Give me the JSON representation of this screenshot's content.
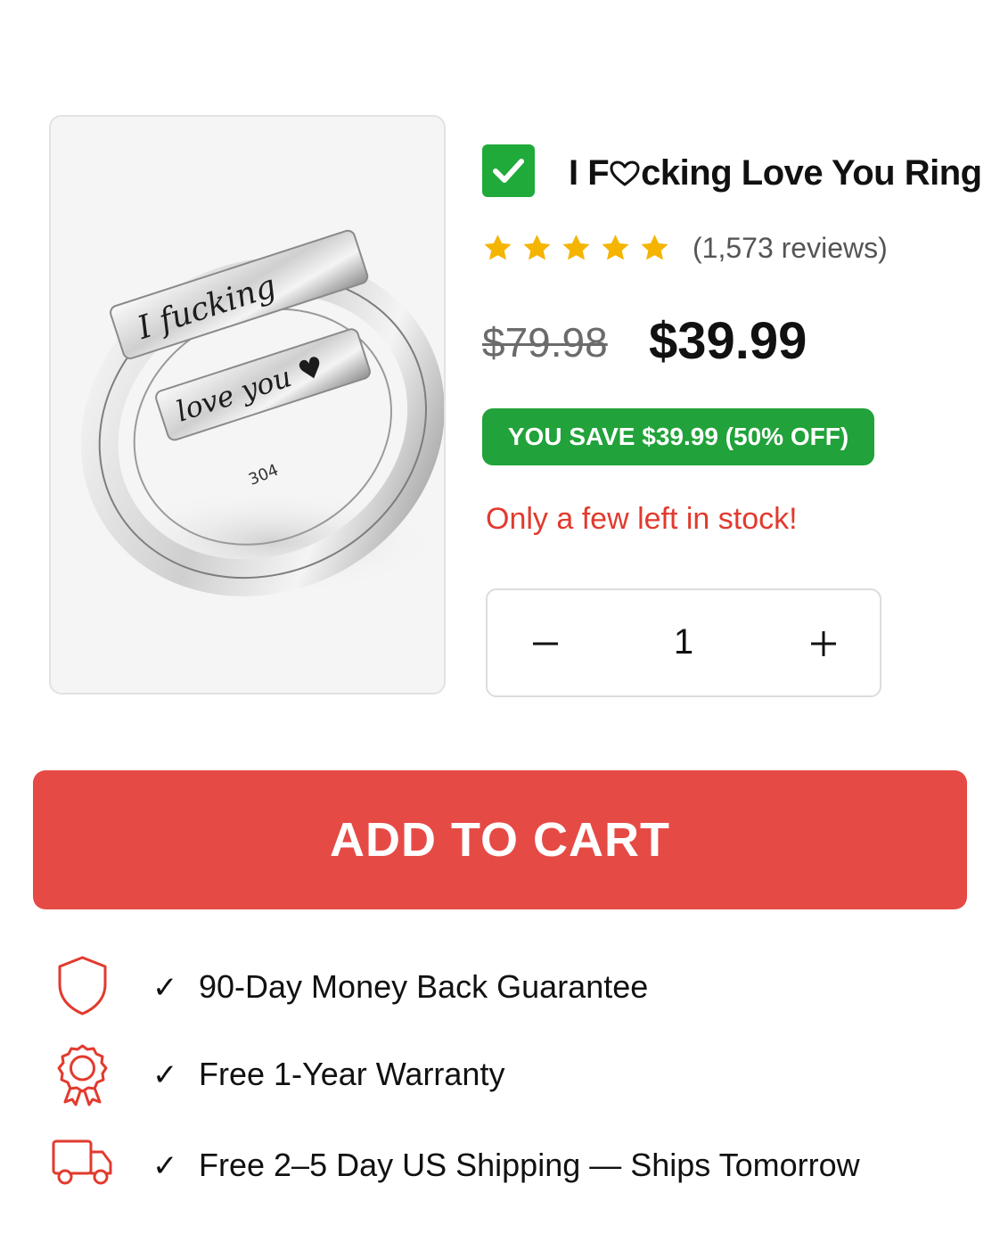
{
  "product": {
    "title_prefix": "I F",
    "title_suffix": "cking Love You Ring",
    "title_heart_icon": "heart-outline-icon",
    "verified_icon": "checkmark-icon",
    "image_alt": "Silver wrap ring engraved I fucking love you",
    "rating": {
      "stars": 5,
      "reviews_label": "(1,573 reviews)"
    },
    "old_price": "$79.98",
    "new_price": "$39.99",
    "save_label": "YOU SAVE $39.99 (50% OFF)",
    "stock_label": "Only a few left in stock!",
    "quantity": "1"
  },
  "cart": {
    "button_label": "ADD TO CART"
  },
  "benefits": [
    {
      "icon": "shield-icon",
      "check": "✓",
      "label": "90-Day Money Back Guarantee"
    },
    {
      "icon": "award-rosette-icon",
      "check": "✓",
      "label": "Free 1-Year Warranty"
    },
    {
      "icon": "delivery-truck-icon",
      "check": "✓",
      "label": "Free 2–5 Day US Shipping — Ships Tomorrow"
    }
  ],
  "colors": {
    "green": "#21a23a",
    "red": "#e64a45",
    "star": "#f5b400",
    "stock_red": "#e23a2e"
  }
}
